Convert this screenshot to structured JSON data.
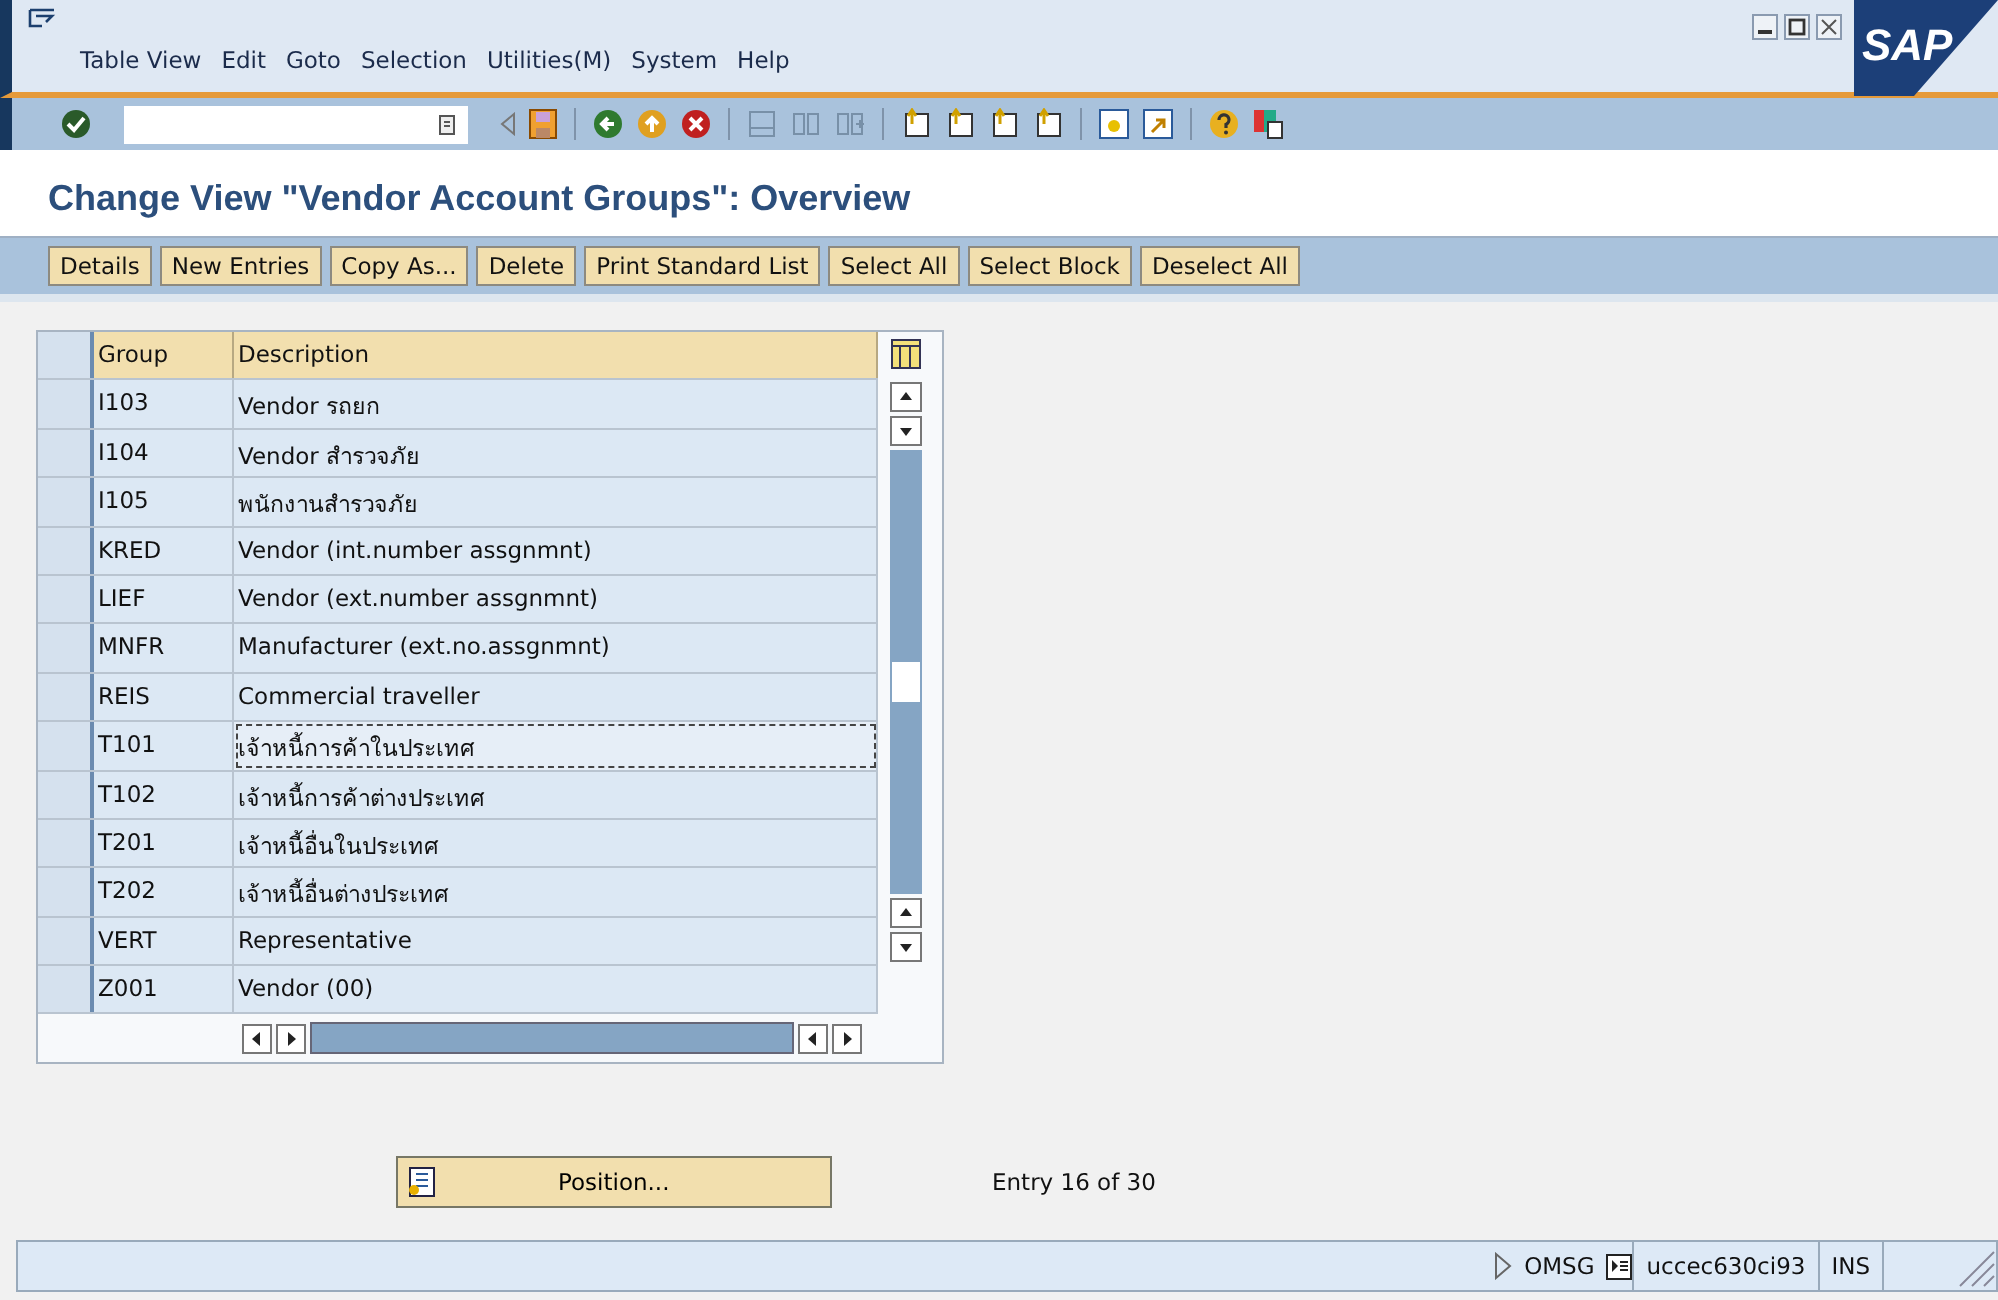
{
  "logo": "SAP",
  "menu": [
    "Table View",
    "Edit",
    "Goto",
    "Selection",
    "Utilities(M)",
    "System",
    "Help"
  ],
  "title": "Change View \"Vendor Account Groups\": Overview",
  "app_buttons": [
    "Details",
    "New Entries",
    "Copy As...",
    "Delete",
    "Print Standard List",
    "Select All",
    "Select Block",
    "Deselect All"
  ],
  "table": {
    "columns": [
      "Group",
      "Description"
    ],
    "rows": [
      {
        "group": "I103",
        "description": "Vendor รถยก",
        "focused": false
      },
      {
        "group": "I104",
        "description": "Vendor สำรวจภัย",
        "focused": false
      },
      {
        "group": "I105",
        "description": "พนักงานสำรวจภัย",
        "focused": false
      },
      {
        "group": "KRED",
        "description": "Vendor (int.number assgnmnt)",
        "focused": false
      },
      {
        "group": "LIEF",
        "description": "Vendor (ext.number assgnmnt)",
        "focused": false
      },
      {
        "group": "MNFR",
        "description": "Manufacturer (ext.no.assgnmnt)",
        "focused": false
      },
      {
        "group": "REIS",
        "description": "Commercial traveller",
        "focused": false
      },
      {
        "group": "T101",
        "description": "เจ้าหนี้การค้าในประเทศ",
        "focused": true
      },
      {
        "group": "T102",
        "description": "เจ้าหนี้การค้าต่างประเทศ",
        "focused": false
      },
      {
        "group": "T201",
        "description": "เจ้าหนี้อื่นในประเทศ",
        "focused": false
      },
      {
        "group": "T202",
        "description": "เจ้าหนี้อื่นต่างประเทศ",
        "focused": false
      },
      {
        "group": "VERT",
        "description": "Representative",
        "focused": false
      },
      {
        "group": "Z001",
        "description": "Vendor (00)",
        "focused": false
      }
    ]
  },
  "position_button": "Position...",
  "entry_info": "Entry 16 of 30",
  "status_bar": {
    "system": "OMSG",
    "server": "uccec630ci93",
    "mode": "INS"
  }
}
